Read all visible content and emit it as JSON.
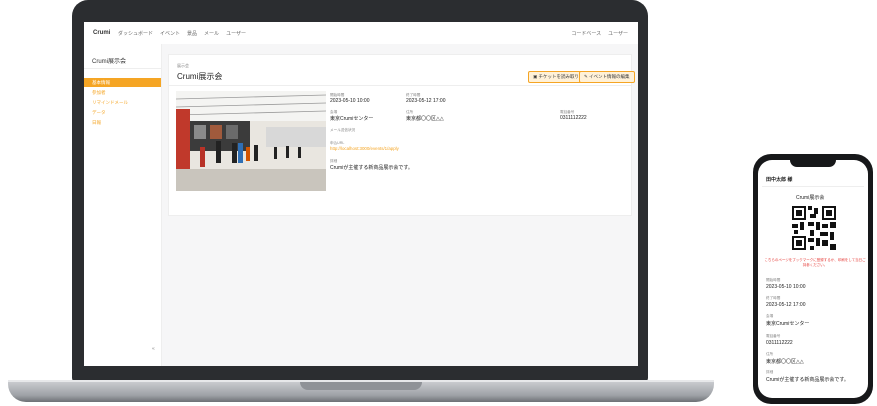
{
  "app": {
    "brand": "Crumi",
    "nav": [
      "ダッシュボード",
      "イベント",
      "景品",
      "メール",
      "ユーザー"
    ],
    "nav_right": [
      "コードベース",
      "ユーザー"
    ]
  },
  "sidebar": {
    "title": "Crumi展示会",
    "items": [
      {
        "label": "基本情報",
        "active": true
      },
      {
        "label": "参加者",
        "active": false
      },
      {
        "label": "リマインドメール",
        "active": false
      },
      {
        "label": "データ",
        "active": false
      },
      {
        "label": "日報",
        "active": false
      }
    ],
    "collapse_glyph": "«"
  },
  "event": {
    "subtitle": "展示会",
    "title": "Crumi展示会",
    "buttons": {
      "ticket": "チケットを読み取り",
      "edit": "イベント情報の編集"
    },
    "start_label": "開始時間",
    "start": "2023-05-10 10:00",
    "end_label": "終了時間",
    "end": "2023-05-12 17:00",
    "venue_label": "会場",
    "venue": "東京Crumiセンター",
    "address_label": "住所",
    "address": "東京都〇〇区△△",
    "phone_label": "電話番号",
    "phone": "0311112222",
    "mail_label": "メール送信状況",
    "url_label": "申込URL",
    "url": "http://localhost:3000/events/1/apply",
    "detail_label": "詳細",
    "detail": "Crumiが主催する新商品展示会です。"
  },
  "mobile": {
    "greeting": "田中太郎 様",
    "event_title": "Crumi展示会",
    "notice": "こちらのページをブックマークに登録するか、印刷をして当日ご持参ください。",
    "start_label": "開始時間",
    "start": "2023-05-10 10:00",
    "end_label": "終了時間",
    "end": "2023-05-12 17:00",
    "venue_label": "会場",
    "venue": "東京Crumiセンター",
    "phone_label": "電話番号",
    "phone": "0311112222",
    "address_label": "住所",
    "address": "東京都〇〇区△△",
    "detail_label": "詳細",
    "detail": "Crumiが主催する新商品展示会です。"
  },
  "colors": {
    "accent": "#f5a524",
    "device": "#2b2d30",
    "warning": "#e53935"
  }
}
